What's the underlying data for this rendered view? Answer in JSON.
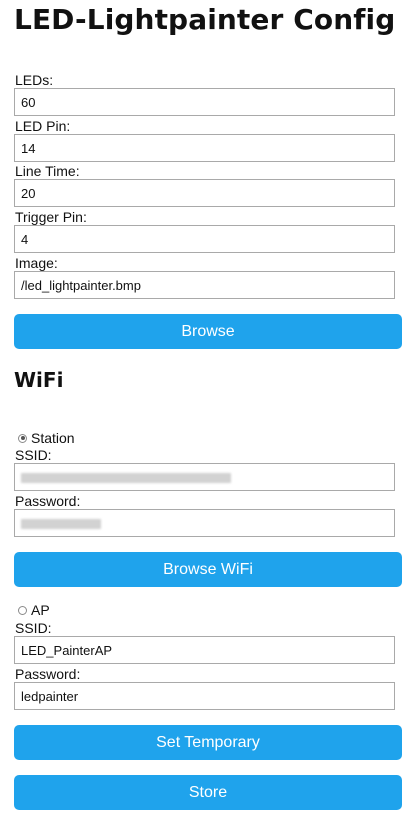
{
  "title": "LED-Lightpainter Config",
  "led_section": {
    "leds": {
      "label": "LEDs:",
      "value": "60"
    },
    "led_pin": {
      "label": "LED Pin:",
      "value": "14"
    },
    "line_time": {
      "label": "Line Time:",
      "value": "20"
    },
    "trigger_pin": {
      "label": "Trigger Pin:",
      "value": "4"
    },
    "image": {
      "label": "Image:",
      "value": "/led_lightpainter.bmp"
    },
    "browse_label": "Browse"
  },
  "wifi": {
    "heading": "WiFi",
    "station": {
      "label": "Station",
      "checked": true,
      "ssid_label": "SSID:",
      "password_label": "Password:"
    },
    "browse_wifi_label": "Browse WiFi",
    "ap": {
      "label": "AP",
      "checked": false,
      "ssid_label": "SSID:",
      "ssid_value": "LED_PainterAP",
      "password_label": "Password:",
      "password_value": "ledpainter"
    }
  },
  "actions": {
    "set_temporary_label": "Set Temporary",
    "store_label": "Store"
  },
  "colors": {
    "button_bg": "#1fa3ec",
    "button_text": "#ffffff",
    "input_border": "#a9a9a9"
  }
}
